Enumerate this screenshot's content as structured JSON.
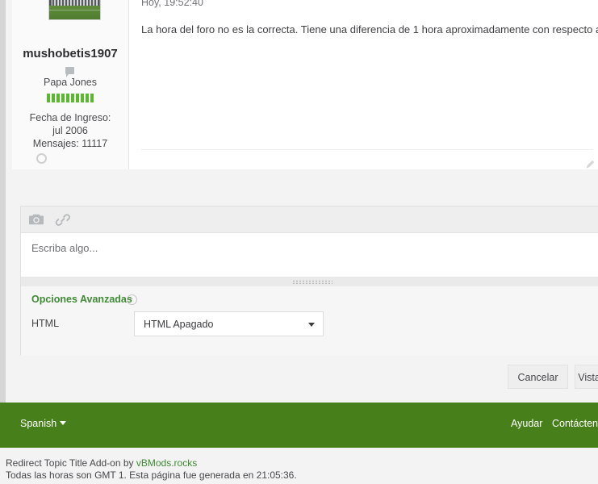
{
  "post": {
    "author": "mushobetis1907",
    "user_title": "Papa Jones",
    "reputation_bars": 10,
    "join_label": "Fecha de Ingreso:",
    "join_date": "jul 2006",
    "messages": "Mensajes: 11117",
    "timestamp": "Hoy, 19:52:40",
    "body": "La hora del foro no es la correcta. Tiene una diferencia de 1 hora aproximadamente con respecto a la hora española."
  },
  "editor": {
    "toolbar": {
      "camera_icon": "camera-icon",
      "link_icon": "link-icon"
    },
    "placeholder": "Escriba algo...",
    "advanced_title": "Opciones Avanzadas",
    "html_label": "HTML",
    "html_value": "HTML Apagado",
    "html_options": [
      "HTML Apagado"
    ]
  },
  "buttons": {
    "cancel": "Cancelar",
    "save": "Vista Previa"
  },
  "footer": {
    "language": "Spanish",
    "help": "Ayudar",
    "contact": "Contáctenos"
  },
  "copyright": {
    "addon_prefix": "Redirect Topic Title Add-on by ",
    "addon_link": "vBMods.rocks",
    "timezone_line": "Todas las horas son GMT 1. Esta página fue generada en 21:05:36."
  },
  "colors": {
    "brand_green": "#47801a",
    "link_green": "#3f8a34",
    "rep_green": "#5ab82e"
  }
}
